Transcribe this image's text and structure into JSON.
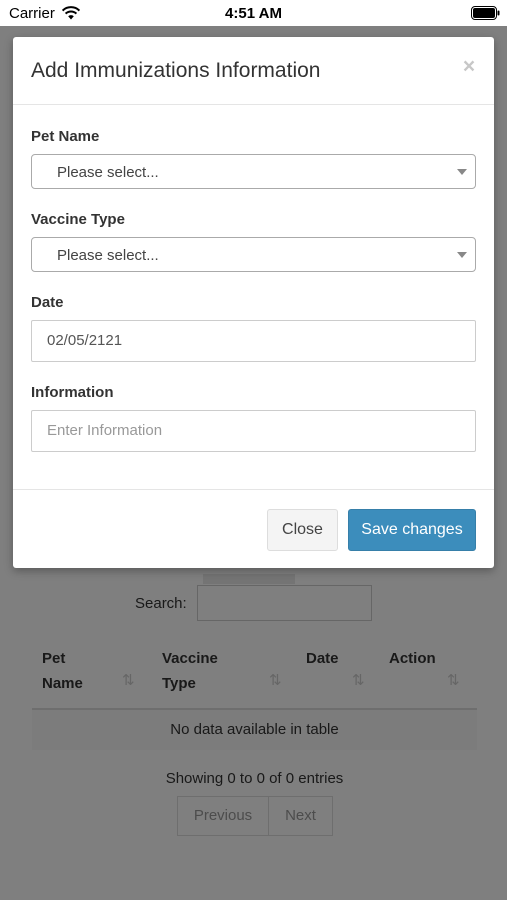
{
  "status_bar": {
    "carrier": "Carrier",
    "time": "4:51 AM",
    "icons": [
      "wifi-icon",
      "battery-icon"
    ]
  },
  "modal": {
    "title": "Add Immunizations Information",
    "close_symbol": "×",
    "fields": {
      "pet_name": {
        "label": "Pet Name",
        "value": "Please select..."
      },
      "vaccine_type": {
        "label": "Vaccine Type",
        "value": "Please select..."
      },
      "date": {
        "label": "Date",
        "value": "02/05/2121"
      },
      "information": {
        "label": "Information",
        "placeholder": "Enter Information",
        "value": ""
      }
    },
    "buttons": {
      "close": "Close",
      "save": "Save changes"
    }
  },
  "background": {
    "search_label": "Search:",
    "table": {
      "headers": [
        {
          "line1": "Pet",
          "line2": "Name"
        },
        {
          "line1": "Vaccine",
          "line2": "Type"
        },
        {
          "line1": "",
          "line2": "Date"
        },
        {
          "line1": "",
          "line2": "Action"
        }
      ],
      "empty_message": "No data available in table",
      "info": "Showing 0 to 0 of 0 entries"
    },
    "pagination": {
      "previous": "Previous",
      "next": "Next"
    }
  },
  "colors": {
    "primary": "#3c8dbc",
    "backdrop": "rgba(0,0,0,0.5)"
  }
}
